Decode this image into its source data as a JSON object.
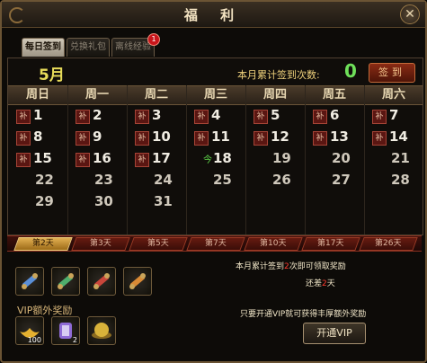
{
  "window": {
    "title": "福 利",
    "close_label": "✕"
  },
  "tabs": [
    {
      "label": "每日签到",
      "active": true
    },
    {
      "label": "兑换礼包",
      "active": false
    },
    {
      "label": "离线经验",
      "active": false
    }
  ],
  "tab_badge": "1",
  "calendar": {
    "month": "5月",
    "sign_count_label": "本月累计签到次数:",
    "sign_count": "0",
    "sign_button": "签到",
    "makeup_label": "补",
    "today_label": "今",
    "weekdays": [
      "周日",
      "周一",
      "周二",
      "周三",
      "周四",
      "周五",
      "周六"
    ],
    "weeks": [
      [
        {
          "d": "1",
          "m": true
        },
        {
          "d": "2",
          "m": true
        },
        {
          "d": "3",
          "m": true
        },
        {
          "d": "4",
          "m": true
        },
        {
          "d": "5",
          "m": true
        },
        {
          "d": "6",
          "m": true
        },
        {
          "d": "7",
          "m": true
        }
      ],
      [
        {
          "d": "8",
          "m": true
        },
        {
          "d": "9",
          "m": true
        },
        {
          "d": "10",
          "m": true
        },
        {
          "d": "11",
          "m": true
        },
        {
          "d": "12",
          "m": true
        },
        {
          "d": "13",
          "m": true
        },
        {
          "d": "14",
          "m": true
        }
      ],
      [
        {
          "d": "15",
          "m": true
        },
        {
          "d": "16",
          "m": true
        },
        {
          "d": "17",
          "m": true
        },
        {
          "d": "18",
          "today": true
        },
        {
          "d": "19"
        },
        {
          "d": "20"
        },
        {
          "d": "21"
        }
      ],
      [
        {
          "d": "22"
        },
        {
          "d": "23"
        },
        {
          "d": "24"
        },
        {
          "d": "25"
        },
        {
          "d": "26"
        },
        {
          "d": "27"
        },
        {
          "d": "28"
        }
      ],
      [
        {
          "d": "29"
        },
        {
          "d": "30"
        },
        {
          "d": "31"
        }
      ]
    ]
  },
  "milestones": [
    {
      "label": "第2天",
      "active": true
    },
    {
      "label": "第3天"
    },
    {
      "label": "第5天"
    },
    {
      "label": "第7天"
    },
    {
      "label": "第10天"
    },
    {
      "label": "第17天"
    },
    {
      "label": "第26天"
    }
  ],
  "rewards": {
    "items": [
      {
        "icon": "blue-scroll-icon",
        "color": "#5a8fd8"
      },
      {
        "icon": "jade-scroll-icon",
        "color": "#4fae6d"
      },
      {
        "icon": "red-scroll-icon",
        "color": "#c9463b"
      },
      {
        "icon": "orange-scroll-icon",
        "color": "#d98a35"
      }
    ],
    "vip_label": "VIP额外奖励",
    "vip_items": [
      {
        "icon": "gold-ingot-icon",
        "qty": "100",
        "color": "#e5b130"
      },
      {
        "icon": "purple-charm-icon",
        "qty": "2",
        "color": "#8f6bd6"
      },
      {
        "icon": "gold-orb-icon",
        "qty": "",
        "color": "#d8b23a"
      }
    ]
  },
  "status": {
    "monthly_prefix": "本月累计签到",
    "monthly_num": "2",
    "monthly_suffix": "次即可领取奖励",
    "remain_prefix": "还差",
    "remain_num": "2",
    "remain_suffix": "天",
    "vip_hint": "只要开通VIP就可获得丰厚额外奖励",
    "vip_button": "开通VIP"
  }
}
